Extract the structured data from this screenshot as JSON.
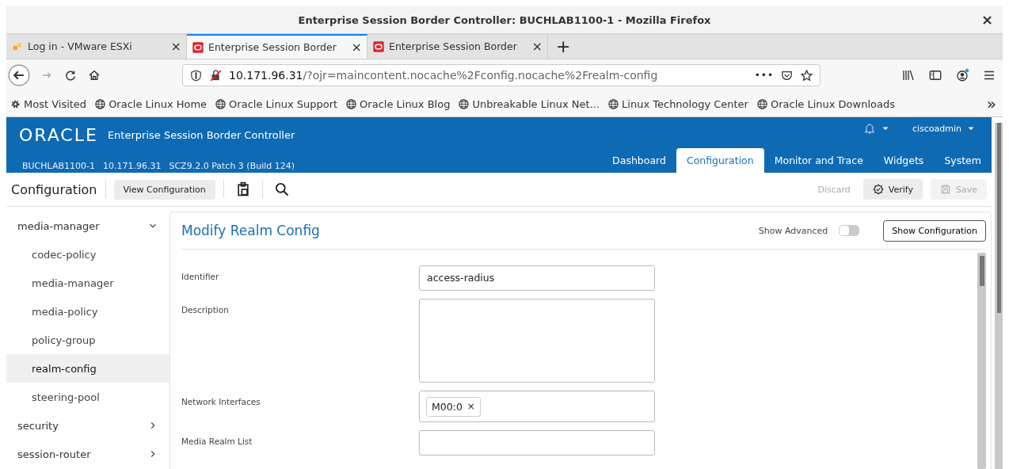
{
  "window": {
    "title": "Enterprise Session Border Controller: BUCHLAB1100-1 - Mozilla Firefox",
    "close": "×"
  },
  "tabs": [
    {
      "label": "Log in - VMware ESXi",
      "selected": false,
      "close": "×"
    },
    {
      "label": "Enterprise Session Border",
      "selected": true,
      "close": "×"
    },
    {
      "label": "Enterprise Session Border",
      "selected": false,
      "close": "×"
    }
  ],
  "new_tab": "+",
  "url": {
    "host": "10.171.96.31",
    "path": "/?ojr=maincontent.nocache%2Fconfig.nocache%2Frealm-config",
    "more": "•••"
  },
  "bookmarks": [
    {
      "label": "Most Visited",
      "kind": "folder"
    },
    {
      "label": "Oracle Linux Home",
      "kind": "link"
    },
    {
      "label": "Oracle Linux Support",
      "kind": "link"
    },
    {
      "label": "Oracle Linux Blog",
      "kind": "link"
    },
    {
      "label": "Unbreakable Linux Net...",
      "kind": "link"
    },
    {
      "label": "Linux Technology Center",
      "kind": "link"
    },
    {
      "label": "Oracle Linux Downloads",
      "kind": "link"
    }
  ],
  "bookmarks_overflow": "»",
  "app": {
    "logo": "ORACLE",
    "product": "Enterprise Session Border Controller",
    "host": "BUCHLAB1100-1",
    "ip": "10.171.96.31",
    "version": "SCZ9.2.0 Patch 3 (Build 124)",
    "user": "ciscoadmin",
    "nav": [
      {
        "label": "Dashboard",
        "selected": false
      },
      {
        "label": "Configuration",
        "selected": true
      },
      {
        "label": "Monitor and Trace",
        "selected": false
      },
      {
        "label": "Widgets",
        "selected": false
      },
      {
        "label": "System",
        "selected": false
      }
    ]
  },
  "toolbar": {
    "title": "Configuration",
    "view_button": "View Configuration",
    "discard": {
      "label": "Discard",
      "disabled": true
    },
    "verify": {
      "label": "Verify",
      "disabled": false
    },
    "save": {
      "label": "Save",
      "disabled": true
    }
  },
  "sidebar": {
    "items": [
      {
        "label": "media-manager",
        "expanded": true,
        "children": [
          {
            "label": "codec-policy",
            "selected": false
          },
          {
            "label": "media-manager",
            "selected": false
          },
          {
            "label": "media-policy",
            "selected": false
          },
          {
            "label": "policy-group",
            "selected": false
          },
          {
            "label": "realm-config",
            "selected": true
          },
          {
            "label": "steering-pool",
            "selected": false
          }
        ]
      },
      {
        "label": "security",
        "expanded": false
      },
      {
        "label": "session-router",
        "expanded": false
      }
    ]
  },
  "form": {
    "title": "Modify Realm Config",
    "show_advanced": {
      "label": "Show Advanced",
      "on": false
    },
    "show_config_button": "Show Configuration",
    "fields": [
      {
        "label": "Identifier",
        "kind": "text",
        "value": "access-radius"
      },
      {
        "label": "Description",
        "kind": "textarea"
      },
      {
        "label": "Network Interfaces",
        "kind": "tags",
        "tags": [
          {
            "label": "M00:0",
            "remove": "×"
          }
        ]
      },
      {
        "label": "Media Realm List",
        "kind": "text"
      }
    ]
  }
}
